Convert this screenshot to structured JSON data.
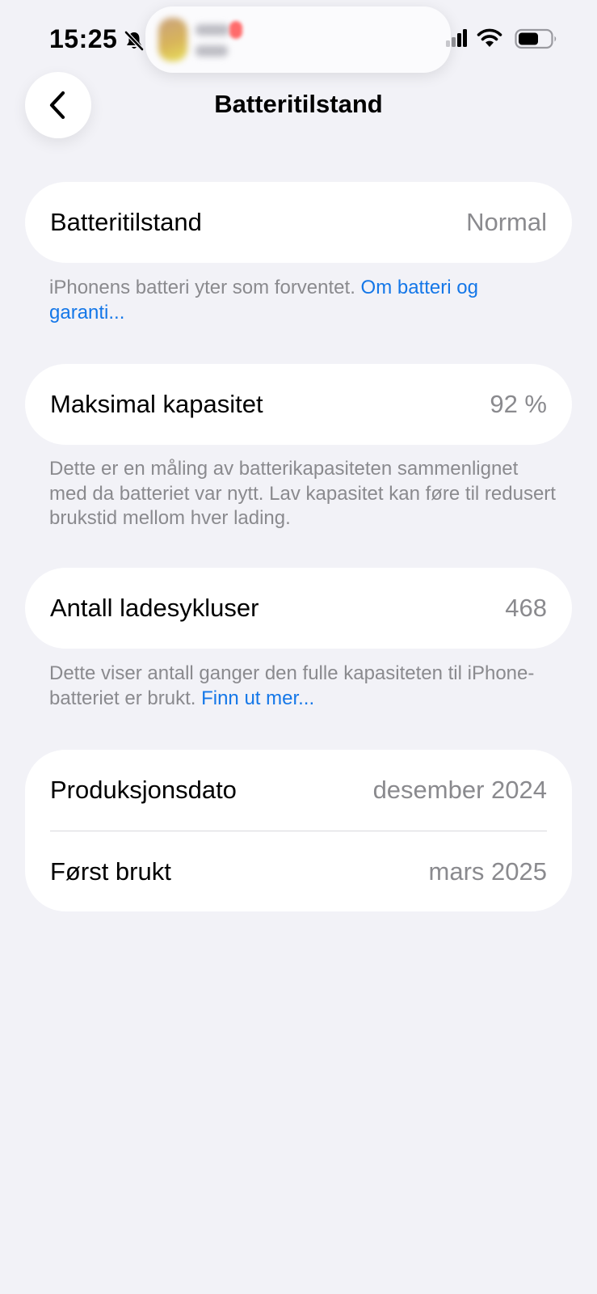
{
  "status_bar": {
    "time": "15:25"
  },
  "nav": {
    "title": "Batteritilstand"
  },
  "sections": {
    "health": {
      "label": "Batteritilstand",
      "value": "Normal",
      "footer_text": "iPhonens batteri yter som forventet. ",
      "footer_link": "Om batteri og garanti..."
    },
    "capacity": {
      "label": "Maksimal kapasitet",
      "value": "92 %",
      "footer_text": "Dette er en måling av batterikapasiteten sammenlignet med da batteriet var nytt. Lav kapasitet kan føre til redusert brukstid mellom hver lading."
    },
    "cycles": {
      "label": "Antall ladesykluser",
      "value": "468",
      "footer_text": "Dette viser antall ganger den fulle kapasiteten til iPhone-batteriet er brukt. ",
      "footer_link": "Finn ut mer..."
    },
    "dates": {
      "manufacture_label": "Produksjonsdato",
      "manufacture_value": "desember 2024",
      "first_use_label": "Først brukt",
      "first_use_value": "mars 2025"
    }
  },
  "colors": {
    "background": "#f2f2f7",
    "link": "#1477e8",
    "secondary_text": "#8a8a8e"
  },
  "icons": {
    "back": "chevron-left-icon",
    "silent": "bell-slash-icon",
    "signal": "cellular-signal-icon",
    "wifi": "wifi-icon",
    "battery": "battery-icon"
  }
}
